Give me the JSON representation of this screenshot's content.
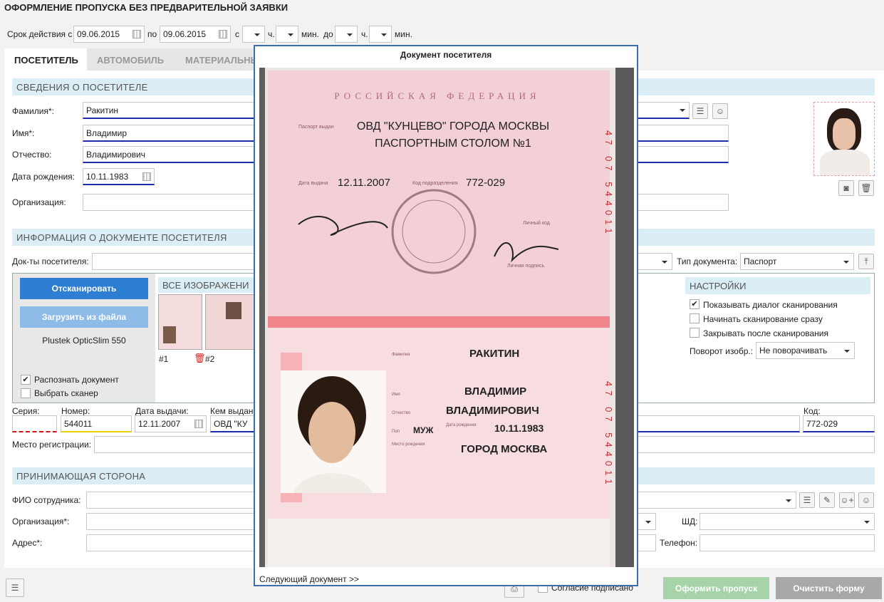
{
  "page_title": "ОФОРМЛЕНИЕ ПРОПУСКА БЕЗ ПРЕДВАРИТЕЛЬНОЙ ЗАЯВКИ",
  "validity": {
    "label": "Срок действия с",
    "from_date": "09.06.2015",
    "to_label": "по",
    "to_date": "09.06.2015",
    "from_time_label": "с",
    "hour_label": "ч.",
    "min_label": "мин.",
    "until_label": "до",
    "hour_label2": "ч.",
    "min_label2": "мин."
  },
  "tabs": [
    "ПОСЕТИТЕЛЬ",
    "АВТОМОБИЛЬ",
    "МАТЕРИАЛЬНЫ"
  ],
  "visitor_section": {
    "title": "СВЕДЕНИЯ О ПОСЕТИТЕЛЕ",
    "lastname_label": "Фамилия*:",
    "lastname": "Ракитин",
    "firstname_label": "Имя*:",
    "firstname": "Владимир",
    "patronymic_label": "Отчество:",
    "patronymic": "Владимирович",
    "birth_label": "Дата рождения:",
    "birth": "10.11.1983",
    "org_label": "Организация:"
  },
  "doc_section": {
    "title": "ИНФОРМАЦИЯ О ДОКУМЕНТЕ ПОСЕТИТЕЛЯ",
    "docs_label": "Док-ты посетителя:",
    "doctype_label": "Тип документа:",
    "doctype": "Паспорт",
    "scan_button": "Отсканировать",
    "load_button": "Загрузить из файла",
    "scanner_name": "Plustek OpticSlim 550",
    "recognize_label": "Распознать документ",
    "choose_scanner_label": "Выбрать сканер",
    "all_images_label": "ВСЕ ИЗОБРАЖЕНИ",
    "thumb1": "#1",
    "thumb2": "#2",
    "settings_title": "НАСТРОЙКИ",
    "opt1": "Показывать диалог сканирования",
    "opt2": "Начинать сканирование сразу",
    "opt3": "Закрывать после сканирования",
    "rotate_label": "Поворот изобр.:",
    "rotate_value": "Не поворачивать",
    "series_label": "Серия:",
    "number_label": "Номер:",
    "number": "544011",
    "issue_date_label": "Дата выдачи:",
    "issue_date": "12.11.2007",
    "issued_by_label": "Кем выдан",
    "issued_by": "ОВД \"КУ",
    "code_label": "Код:",
    "code": "772-029",
    "registration_label": "Место регистрации:"
  },
  "host_section": {
    "title": "ПРИНИМАЮЩАЯ СТОРОНА",
    "employee_label": "ФИО сотрудника:",
    "org_label": "Организация*:",
    "shd_label": "ШД:",
    "address_label": "Адрес*:",
    "phone_label": "Телефон:"
  },
  "footer": {
    "consent_label": "Согласие подписано",
    "issue_button": "Оформить пропуск",
    "clear_button": "Очистить форму"
  },
  "modal": {
    "title": "Документ посетителя",
    "next_link": "Следующий документ >>",
    "passport": {
      "country": "РОССИЙСКАЯ ФЕДЕРАЦИЯ",
      "issued_by_caption": "Паспорт выдан",
      "issued_by_line1": "ОВД \"КУНЦЕВО\" ГОРОДА МОСКВЫ",
      "issued_by_line2": "ПАСПОРТНЫМ СТОЛОМ №1",
      "issue_date_caption": "Дата выдачи",
      "issue_date": "12.11.2007",
      "code_caption": "Код подразделения",
      "code": "772-029",
      "personal_code_caption": "Личный код",
      "signature_caption": "Личная подпись",
      "serial_vertical": "47 07 544011",
      "lastname_caption": "Фамилия",
      "lastname": "РАКИТИН",
      "name_caption": "Имя",
      "name": "ВЛАДИМИР",
      "patronymic_caption": "Отчество",
      "patronymic": "ВЛАДИМИРОВИЧ",
      "sex_caption": "Пол",
      "sex": "МУЖ",
      "birthdate_caption": "Дата рождения",
      "birthdate": "10.11.1983",
      "birthplace_caption": "Место рождения",
      "birthplace": "ГОРОД МОСКВА"
    }
  }
}
